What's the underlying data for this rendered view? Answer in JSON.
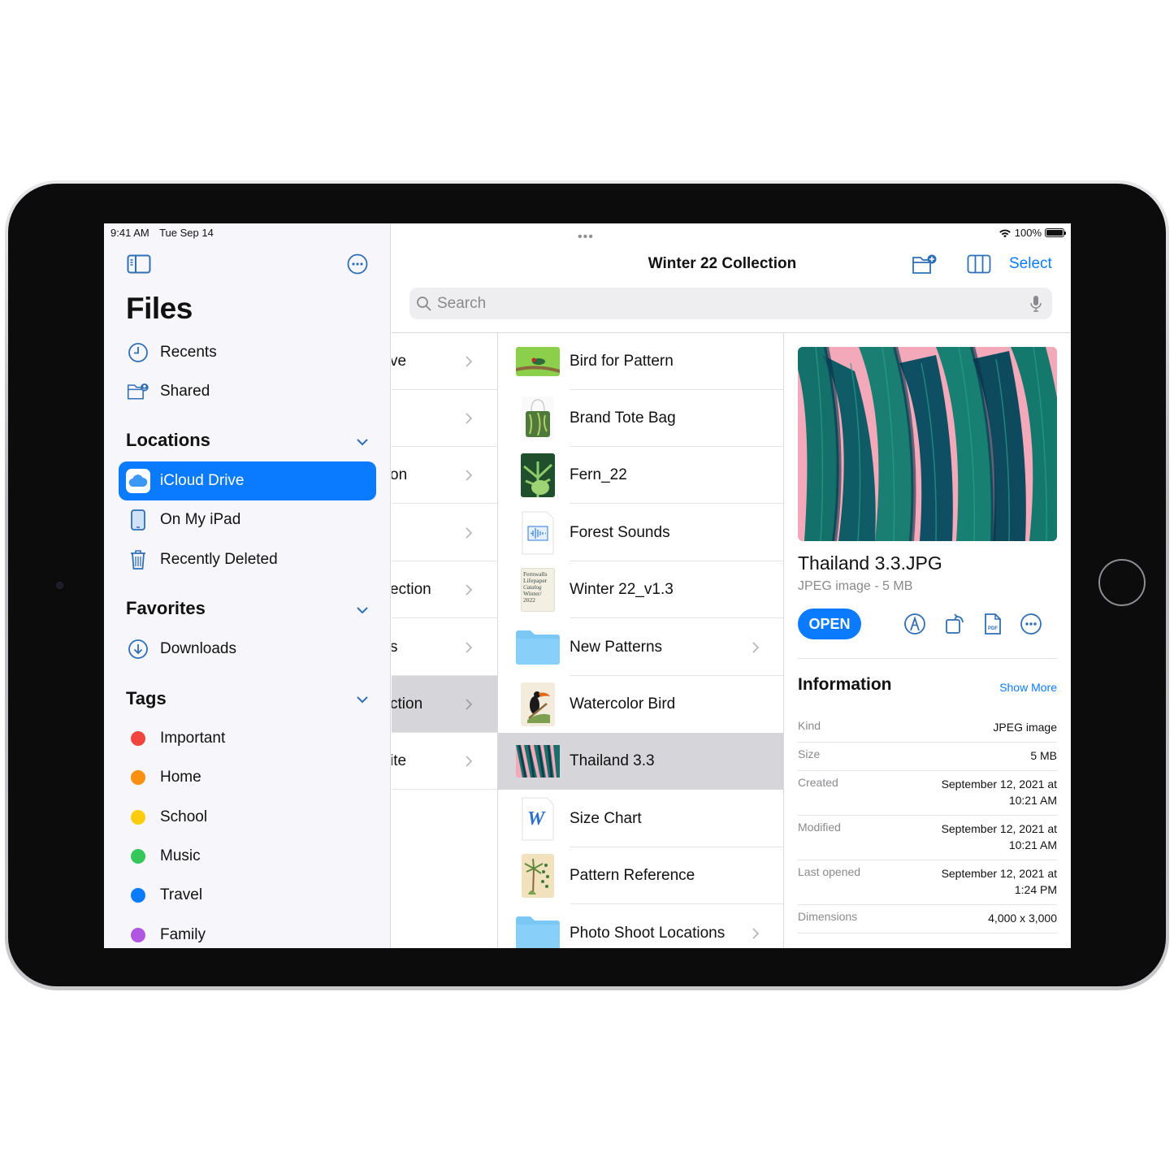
{
  "status_bar": {
    "time": "9:41 AM",
    "date": "Tue Sep 14",
    "battery": "100%"
  },
  "sidebar": {
    "title": "Files",
    "top_items": [
      {
        "label": "Recents",
        "icon": "clock-icon"
      },
      {
        "label": "Shared",
        "icon": "shared-folder-icon"
      }
    ],
    "locations": {
      "header": "Locations",
      "items": [
        {
          "label": "iCloud Drive",
          "icon": "icloud-icon",
          "selected": true
        },
        {
          "label": "On My iPad",
          "icon": "ipad-icon"
        },
        {
          "label": "Recently Deleted",
          "icon": "trash-icon"
        }
      ]
    },
    "favorites": {
      "header": "Favorites",
      "items": [
        {
          "label": "Downloads",
          "icon": "download-icon"
        }
      ]
    },
    "tags": {
      "header": "Tags",
      "items": [
        {
          "label": "Important",
          "color": "#f2453d"
        },
        {
          "label": "Home",
          "color": "#fb9010"
        },
        {
          "label": "School",
          "color": "#fdcc0d"
        },
        {
          "label": "Music",
          "color": "#35c759"
        },
        {
          "label": "Travel",
          "color": "#0a7aff"
        },
        {
          "label": "Family",
          "color": "#b056e0"
        }
      ]
    }
  },
  "toolbar": {
    "title": "Winter 22 Collection",
    "select_label": "Select",
    "search_placeholder": "Search"
  },
  "column1": {
    "rows": [
      {
        "text": "ve"
      },
      {
        "text": ""
      },
      {
        "text": "on"
      },
      {
        "text": ""
      },
      {
        "text": "ection"
      },
      {
        "text": "s"
      },
      {
        "text": "ction",
        "selected": true
      },
      {
        "text": "ite"
      }
    ]
  },
  "column2": {
    "rows": [
      {
        "name": "Bird for Pattern",
        "kind": "image-bird"
      },
      {
        "name": "Brand Tote Bag",
        "kind": "image-tote"
      },
      {
        "name": "Fern_22",
        "kind": "image-fern"
      },
      {
        "name": "Forest Sounds",
        "kind": "audio"
      },
      {
        "name": "Winter 22_v1.3",
        "kind": "catalog",
        "catalog_text": "Fernwalls Lifepaper Catalog Winter/ 2022"
      },
      {
        "name": "New Patterns",
        "kind": "folder"
      },
      {
        "name": "Watercolor Bird",
        "kind": "image-toucan"
      },
      {
        "name": "Thailand 3.3",
        "kind": "image-leaves",
        "selected": true
      },
      {
        "name": "Size Chart",
        "kind": "word",
        "glyph": "W"
      },
      {
        "name": "Pattern Reference",
        "kind": "image-palm"
      },
      {
        "name": "Photo Shoot Locations",
        "kind": "folder"
      }
    ]
  },
  "detail": {
    "filename": "Thailand 3.3.JPG",
    "subtitle": "JPEG image - 5 MB",
    "open_label": "OPEN",
    "info_title": "Information",
    "show_more": "Show More",
    "info": [
      {
        "key": "Kind",
        "value": [
          "JPEG image"
        ]
      },
      {
        "key": "Size",
        "value": [
          "5 MB"
        ]
      },
      {
        "key": "Created",
        "value": [
          "September 12, 2021 at",
          "10:21 AM"
        ]
      },
      {
        "key": "Modified",
        "value": [
          "September 12, 2021 at",
          "10:21 AM"
        ]
      },
      {
        "key": "Last opened",
        "value": [
          "September 12, 2021 at",
          "1:24 PM"
        ]
      },
      {
        "key": "Dimensions",
        "value": [
          "4,000 x 3,000"
        ]
      }
    ]
  },
  "colors": {
    "accent": "#0a7aff",
    "icon_blue": "#2f6fb5",
    "selection_gray": "#d6d6da",
    "preview_pink": "#f3a9b9",
    "leaf_teal": "#137a6c"
  }
}
